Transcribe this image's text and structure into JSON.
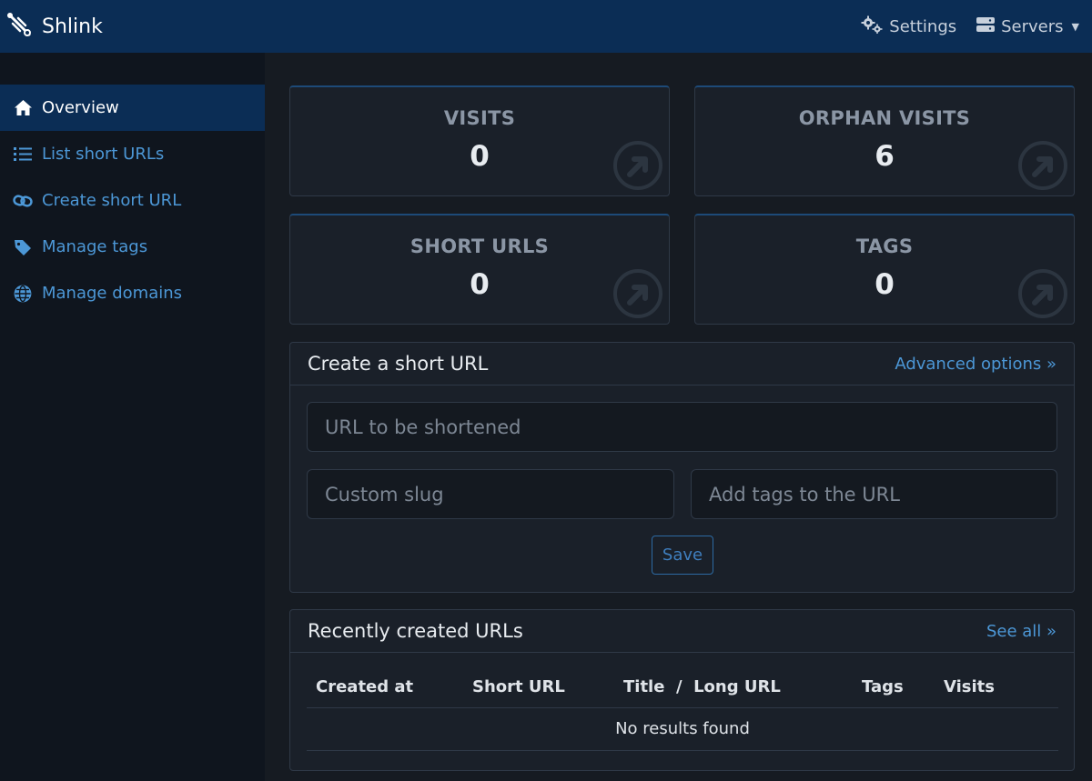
{
  "app": {
    "title": "Shlink",
    "settings_label": "Settings",
    "servers_label": "Servers"
  },
  "sidebar": {
    "items": [
      {
        "label": "Overview",
        "icon": "home-icon",
        "active": true
      },
      {
        "label": "List short URLs",
        "icon": "list-icon",
        "active": false
      },
      {
        "label": "Create short URL",
        "icon": "link-icon",
        "active": false
      },
      {
        "label": "Manage tags",
        "icon": "tags-icon",
        "active": false
      },
      {
        "label": "Manage domains",
        "icon": "globe-icon",
        "active": false
      }
    ]
  },
  "stats": [
    {
      "label": "VISITS",
      "value": "0"
    },
    {
      "label": "ORPHAN VISITS",
      "value": "6"
    },
    {
      "label": "SHORT URLS",
      "value": "0"
    },
    {
      "label": "TAGS",
      "value": "0"
    }
  ],
  "create_form": {
    "title": "Create a short URL",
    "advanced_link": "Advanced options »",
    "url_placeholder": "URL to be shortened",
    "slug_placeholder": "Custom slug",
    "tags_placeholder": "Add tags to the URL",
    "save_label": "Save"
  },
  "recent": {
    "title": "Recently created URLs",
    "see_all": "See all »",
    "columns": [
      "Created at",
      "Short URL",
      "Title  /  Long URL",
      "Tags",
      "Visits"
    ],
    "empty_message": "No results found"
  },
  "colors": {
    "header_bg": "#0b2d55",
    "sidebar_bg": "#0f151e",
    "main_bg": "#161b22",
    "accent_link": "#4c97d6"
  }
}
